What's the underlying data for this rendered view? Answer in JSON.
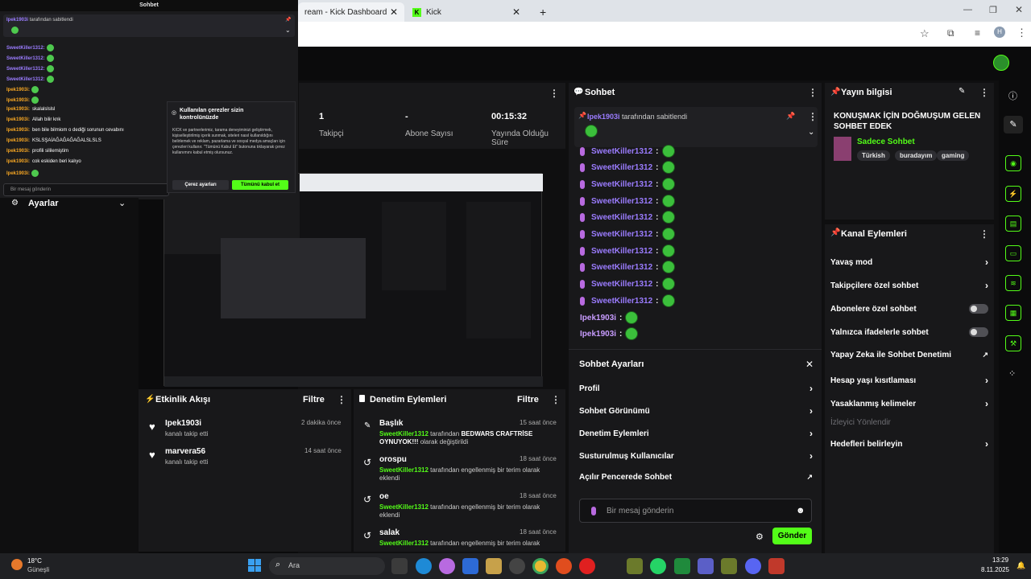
{
  "browser": {
    "tab1": "ream - Kick Dashboard",
    "tab2": "Kick",
    "new_tab": "+"
  },
  "overlay": {
    "title": "Sohbet",
    "pinned_by": "Ipek1903i",
    "pinned_text": "tarafından sabitlendi",
    "messages": [
      {
        "user": "SweetKiller1312:",
        "text": ""
      },
      {
        "user": "SweetKiller1312:",
        "text": ""
      },
      {
        "user": "SweetKiller1312:",
        "text": ""
      },
      {
        "user": "SweetKiller1312:",
        "text": ""
      },
      {
        "user": "Ipek1903i:",
        "text": ""
      },
      {
        "user": "Ipek1903i:",
        "text": ""
      },
      {
        "user": "Ipek1903i:",
        "text": "skalalslslsl"
      },
      {
        "user": "Ipek1903i:",
        "text": "Allah bilir knk"
      },
      {
        "user": "Ipek1903i:",
        "text": "ben bile bilmiom o dediği sorunun cevabını"
      },
      {
        "user": "Ipek1903i:",
        "text": "KSLSŞAİAĞAĞAĞAĞALSLSLS"
      },
      {
        "user": "Ipek1903i:",
        "text": "profili sililemiştim"
      },
      {
        "user": "Ipek1903i:",
        "text": "cok eskiden beri kalıyo"
      },
      {
        "user": "Ipek1903i:",
        "text": ""
      }
    ],
    "input_placeholder": "Bir mesaj gönderin",
    "settings_label": "Ayarlar"
  },
  "cookie": {
    "title": "Kullanılan çerezler sizin kontrolünüzde",
    "body": "KICK ve partnerlerimiz, tarama deneyiminizi geliştirmek, kişiselleştirilmiş içerik sunmak, siteleri nasıl kullanıldığını belirlemek ve reklam, pazarlama ve sosyal medya amaçları için çerezleri kullanır. \"Tümünü Kabul Et\" butonuna tıklayarak çerez kullanımını kabul etmiş olursunuz.",
    "settings_btn": "Çerez ayarları",
    "accept_btn": "Tümünü kabul et"
  },
  "stats": [
    {
      "value": "1",
      "label": "Takipçi"
    },
    {
      "value": "-",
      "label": "Abone Sayısı"
    },
    {
      "value": "00:15:32",
      "label": "Yayında Olduğu Süre"
    }
  ],
  "activity": {
    "title": "Etkinlik Akışı",
    "filter": "Filtre",
    "items": [
      {
        "user": "Ipek1903i",
        "desc": "kanalı takip etti",
        "time": "2 dakika önce"
      },
      {
        "user": "marvera56",
        "desc": "kanalı takip etti",
        "time": "14 saat önce"
      }
    ]
  },
  "moderation": {
    "title": "Denetim Eylemleri",
    "filter": "Filtre",
    "items": [
      {
        "title": "Başlık",
        "user": "SweetKiller1312",
        "mid": "tarafından",
        "bold": "BEDWARS CRAFTRİSE OYNUYOK!!!",
        "tail": "olarak değiştirildi",
        "time": "15 saat önce"
      },
      {
        "title": "orospu",
        "user": "SweetKiller1312",
        "mid": "tarafından engellenmiş bir terim olarak eklendi",
        "bold": "",
        "tail": "",
        "time": "18 saat önce"
      },
      {
        "title": "oe",
        "user": "SweetKiller1312",
        "mid": "tarafından engellenmiş bir terim olarak eklendi",
        "bold": "",
        "tail": "",
        "time": "18 saat önce"
      },
      {
        "title": "salak",
        "user": "SweetKiller1312",
        "mid": "tarafından engellenmiş bir terim olarak",
        "bold": "",
        "tail": "",
        "time": "18 saat önce"
      }
    ]
  },
  "chat": {
    "title": "Sohbet",
    "pinned_by": "Ipek1903i",
    "pinned_text": "tarafından sabitlendi",
    "messages": [
      {
        "user": "SweetKiller1312",
        "color": "#9b7cff"
      },
      {
        "user": "SweetKiller1312",
        "color": "#9b7cff"
      },
      {
        "user": "SweetKiller1312",
        "color": "#9b7cff"
      },
      {
        "user": "SweetKiller1312",
        "color": "#9b7cff"
      },
      {
        "user": "SweetKiller1312",
        "color": "#9b7cff"
      },
      {
        "user": "SweetKiller1312",
        "color": "#9b7cff"
      },
      {
        "user": "SweetKiller1312",
        "color": "#9b7cff"
      },
      {
        "user": "SweetKiller1312",
        "color": "#9b7cff"
      },
      {
        "user": "SweetKiller1312",
        "color": "#9b7cff"
      },
      {
        "user": "SweetKiller1312",
        "color": "#9b7cff"
      },
      {
        "user": "Ipek1903i",
        "color": "#c89cff"
      },
      {
        "user": "Ipek1903i",
        "color": "#c89cff"
      }
    ],
    "settings_title": "Sohbet Ayarları",
    "settings_items": [
      "Profil",
      "Sohbet Görünümü",
      "Denetim Eylemleri",
      "Susturulmuş Kullanıcılar",
      "Açılır Pencerede Sohbet"
    ],
    "input_placeholder": "Bir mesaj gönderin",
    "send": "Gönder"
  },
  "stream_info": {
    "title": "Yayın bilgisi",
    "stream_title": "KONUŞMAK İÇİN DOĞMUŞUM GELEN SOHBET EDEK",
    "category": "Sadece Sohbet",
    "tags": [
      "Türkish",
      "buradayım",
      "gaming"
    ]
  },
  "channel_actions": {
    "title": "Kanal Eylemleri",
    "items": [
      {
        "label": "Yavaş mod",
        "type": "chevron"
      },
      {
        "label": "Takipçilere özel sohbet",
        "type": "chevron"
      },
      {
        "label": "Abonelere özel sohbet",
        "type": "toggle"
      },
      {
        "label": "Yalnızca ifadelerle sohbet",
        "type": "toggle"
      },
      {
        "label": "Yapay Zeka ile Sohbet Denetimi",
        "type": "external"
      },
      {
        "label": "Hesap yaşı kısıtlaması",
        "type": "chevron"
      },
      {
        "label": "Yasaklanmış kelimeler",
        "type": "chevron"
      },
      {
        "label": "İzleyici Yönlendir",
        "type": "disabled"
      },
      {
        "label": "Hedefleri belirleyin",
        "type": "chevron"
      }
    ]
  },
  "taskbar": {
    "weather_temp": "18°C",
    "weather_desc": "Güneşli",
    "search": "Ara",
    "time": "13:29",
    "date": "8.11.2025"
  }
}
